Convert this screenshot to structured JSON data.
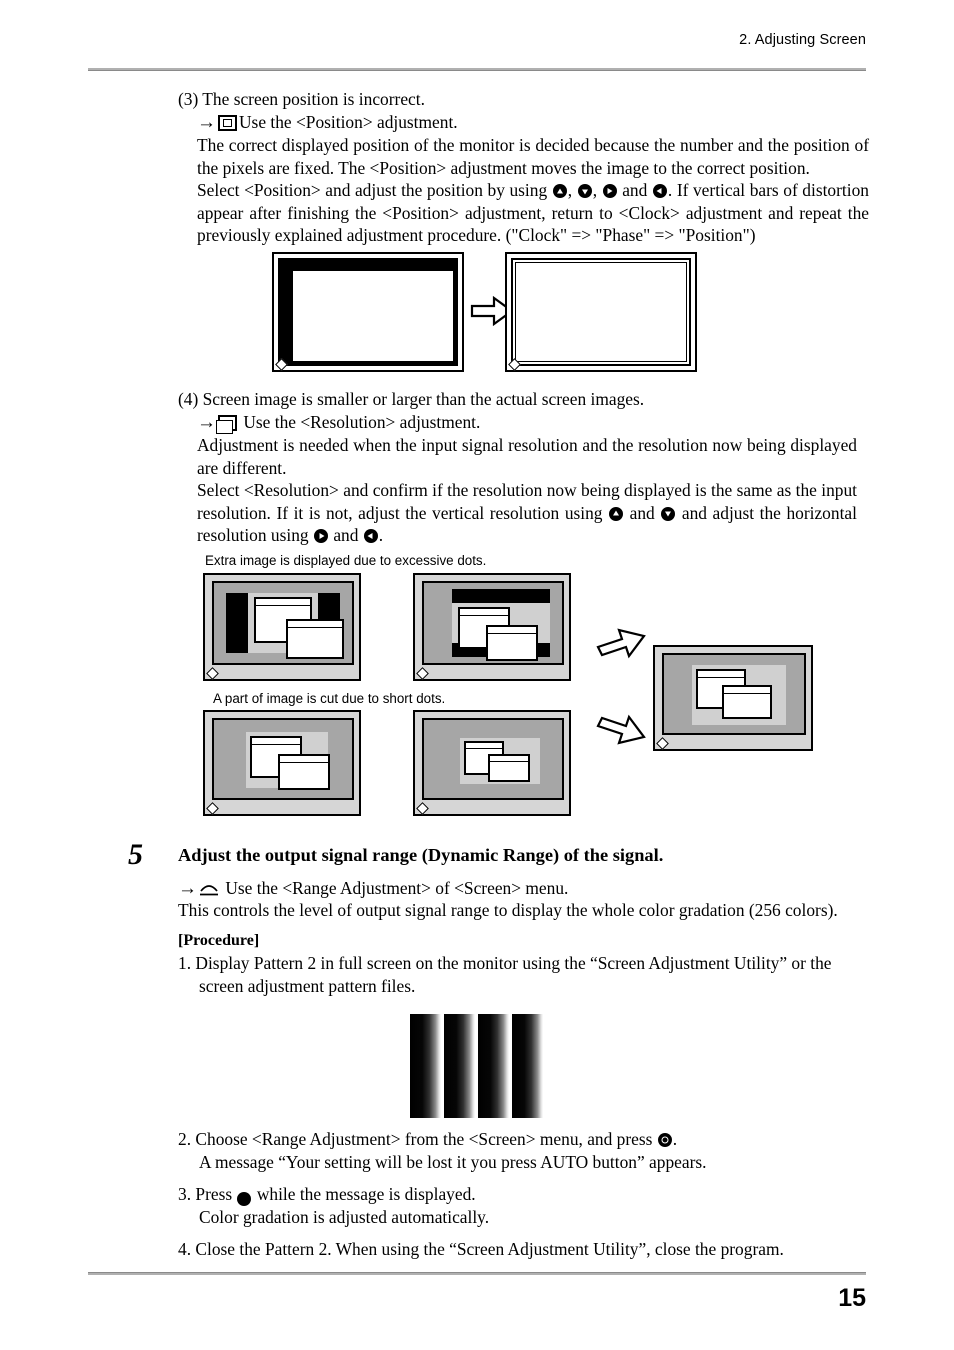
{
  "header": {
    "chapter": "2. Adjusting Screen"
  },
  "footer": {
    "page_number": "15"
  },
  "sections": {
    "item3": {
      "heading": "(3) The screen position is incorrect.",
      "use_line_prefix": "→",
      "use_line_text": "Use the <Position> adjustment.",
      "para1": "The correct displayed position of the monitor is decided because the number and the position of the pixels are fixed. The <Position> adjustment moves the image to the correct position.",
      "para2_a": "Select <Position> and adjust the position by using",
      "para2_b": ",",
      "para2_c": ",",
      "para2_d": "and",
      "para2_e": ". If vertical bars of distortion appear after finishing the <Position> adjustment, return to <Clock> adjustment and repeat the previously explained adjustment procedure. (\"Clock\" => \"Phase\" => \"Position\")"
    },
    "item4": {
      "heading": "(4) Screen image is smaller or larger than the actual screen images.",
      "use_line_prefix": "→",
      "use_line_text": "Use the <Resolution> adjustment.",
      "para1": "Adjustment is needed when the input signal resolution and the resolution now being displayed are different.",
      "para2_a": "Select <Resolution> and confirm if the resolution now being displayed is the same as the input resolution. If it is not, adjust the vertical resolution using",
      "para2_b": "and",
      "para2_c": "and adjust the horizontal resolution using",
      "para2_d": "and",
      "para2_e": ".",
      "caption_excess": "Extra image is displayed due to excessive dots.",
      "caption_short": "A part of image is cut due to short dots."
    },
    "step5": {
      "number": "5",
      "title": "Adjust the output signal range (Dynamic Range) of the signal.",
      "use_line_prefix": "→",
      "use_line_text": "Use the <Range Adjustment> of <Screen> menu.",
      "para1": "This controls the level of output signal range to display the whole color gradation (256 colors).",
      "procedure_label": "[Procedure]",
      "steps": [
        {
          "num": "1.",
          "line1": "Display Pattern 2 in full screen on the monitor using the “Screen Adjustment Utility” or the",
          "line2": "screen adjustment pattern files."
        },
        {
          "num": "2.",
          "line1_a": "Choose <Range Adjustment> from the <Screen> menu, and press",
          "line1_b": ".",
          "line2": "A message “Your setting will be lost it you press AUTO button” appears."
        },
        {
          "num": "3.",
          "line1_a": "Press",
          "line1_b": "while the message is displayed.",
          "line2": "Color gradation is adjusted automatically."
        },
        {
          "num": "4.",
          "line1": "Close the Pattern 2. When using the “Screen Adjustment Utility”, close the program.",
          "line2": ""
        }
      ]
    }
  },
  "icons": {
    "up_button": "up-arrow-button",
    "down_button": "down-arrow-button",
    "right_button": "right-arrow-button",
    "left_button": "left-arrow-button",
    "enter_button": "enter-button",
    "auto_button": "A",
    "position_menu": "position-menu-icon",
    "resolution_menu": "resolution-menu-icon",
    "range_menu": "range-adjustment-menu-icon"
  },
  "colors": {
    "rule": "#b0b0b0",
    "screen_gray": "#a6a6a6",
    "bezel_light": "#d6d6d6",
    "window_gray": "#d0d0d0",
    "black": "#000000",
    "white": "#ffffff"
  },
  "pattern": {
    "name": "Pattern 2",
    "bands": 4,
    "description": "black to white horizontal gradation bands"
  }
}
